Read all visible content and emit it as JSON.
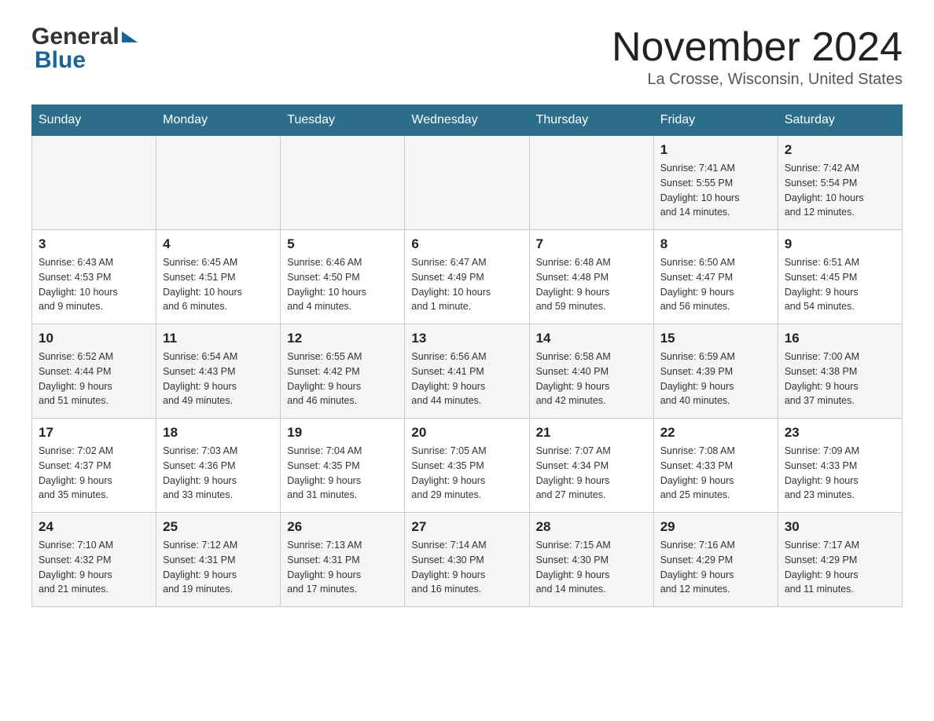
{
  "logo": {
    "line1": "General",
    "line2": "Blue"
  },
  "header": {
    "month": "November 2024",
    "location": "La Crosse, Wisconsin, United States"
  },
  "weekdays": [
    "Sunday",
    "Monday",
    "Tuesday",
    "Wednesday",
    "Thursday",
    "Friday",
    "Saturday"
  ],
  "weeks": [
    [
      {
        "day": "",
        "info": ""
      },
      {
        "day": "",
        "info": ""
      },
      {
        "day": "",
        "info": ""
      },
      {
        "day": "",
        "info": ""
      },
      {
        "day": "",
        "info": ""
      },
      {
        "day": "1",
        "info": "Sunrise: 7:41 AM\nSunset: 5:55 PM\nDaylight: 10 hours\nand 14 minutes."
      },
      {
        "day": "2",
        "info": "Sunrise: 7:42 AM\nSunset: 5:54 PM\nDaylight: 10 hours\nand 12 minutes."
      }
    ],
    [
      {
        "day": "3",
        "info": "Sunrise: 6:43 AM\nSunset: 4:53 PM\nDaylight: 10 hours\nand 9 minutes."
      },
      {
        "day": "4",
        "info": "Sunrise: 6:45 AM\nSunset: 4:51 PM\nDaylight: 10 hours\nand 6 minutes."
      },
      {
        "day": "5",
        "info": "Sunrise: 6:46 AM\nSunset: 4:50 PM\nDaylight: 10 hours\nand 4 minutes."
      },
      {
        "day": "6",
        "info": "Sunrise: 6:47 AM\nSunset: 4:49 PM\nDaylight: 10 hours\nand 1 minute."
      },
      {
        "day": "7",
        "info": "Sunrise: 6:48 AM\nSunset: 4:48 PM\nDaylight: 9 hours\nand 59 minutes."
      },
      {
        "day": "8",
        "info": "Sunrise: 6:50 AM\nSunset: 4:47 PM\nDaylight: 9 hours\nand 56 minutes."
      },
      {
        "day": "9",
        "info": "Sunrise: 6:51 AM\nSunset: 4:45 PM\nDaylight: 9 hours\nand 54 minutes."
      }
    ],
    [
      {
        "day": "10",
        "info": "Sunrise: 6:52 AM\nSunset: 4:44 PM\nDaylight: 9 hours\nand 51 minutes."
      },
      {
        "day": "11",
        "info": "Sunrise: 6:54 AM\nSunset: 4:43 PM\nDaylight: 9 hours\nand 49 minutes."
      },
      {
        "day": "12",
        "info": "Sunrise: 6:55 AM\nSunset: 4:42 PM\nDaylight: 9 hours\nand 46 minutes."
      },
      {
        "day": "13",
        "info": "Sunrise: 6:56 AM\nSunset: 4:41 PM\nDaylight: 9 hours\nand 44 minutes."
      },
      {
        "day": "14",
        "info": "Sunrise: 6:58 AM\nSunset: 4:40 PM\nDaylight: 9 hours\nand 42 minutes."
      },
      {
        "day": "15",
        "info": "Sunrise: 6:59 AM\nSunset: 4:39 PM\nDaylight: 9 hours\nand 40 minutes."
      },
      {
        "day": "16",
        "info": "Sunrise: 7:00 AM\nSunset: 4:38 PM\nDaylight: 9 hours\nand 37 minutes."
      }
    ],
    [
      {
        "day": "17",
        "info": "Sunrise: 7:02 AM\nSunset: 4:37 PM\nDaylight: 9 hours\nand 35 minutes."
      },
      {
        "day": "18",
        "info": "Sunrise: 7:03 AM\nSunset: 4:36 PM\nDaylight: 9 hours\nand 33 minutes."
      },
      {
        "day": "19",
        "info": "Sunrise: 7:04 AM\nSunset: 4:35 PM\nDaylight: 9 hours\nand 31 minutes."
      },
      {
        "day": "20",
        "info": "Sunrise: 7:05 AM\nSunset: 4:35 PM\nDaylight: 9 hours\nand 29 minutes."
      },
      {
        "day": "21",
        "info": "Sunrise: 7:07 AM\nSunset: 4:34 PM\nDaylight: 9 hours\nand 27 minutes."
      },
      {
        "day": "22",
        "info": "Sunrise: 7:08 AM\nSunset: 4:33 PM\nDaylight: 9 hours\nand 25 minutes."
      },
      {
        "day": "23",
        "info": "Sunrise: 7:09 AM\nSunset: 4:33 PM\nDaylight: 9 hours\nand 23 minutes."
      }
    ],
    [
      {
        "day": "24",
        "info": "Sunrise: 7:10 AM\nSunset: 4:32 PM\nDaylight: 9 hours\nand 21 minutes."
      },
      {
        "day": "25",
        "info": "Sunrise: 7:12 AM\nSunset: 4:31 PM\nDaylight: 9 hours\nand 19 minutes."
      },
      {
        "day": "26",
        "info": "Sunrise: 7:13 AM\nSunset: 4:31 PM\nDaylight: 9 hours\nand 17 minutes."
      },
      {
        "day": "27",
        "info": "Sunrise: 7:14 AM\nSunset: 4:30 PM\nDaylight: 9 hours\nand 16 minutes."
      },
      {
        "day": "28",
        "info": "Sunrise: 7:15 AM\nSunset: 4:30 PM\nDaylight: 9 hours\nand 14 minutes."
      },
      {
        "day": "29",
        "info": "Sunrise: 7:16 AM\nSunset: 4:29 PM\nDaylight: 9 hours\nand 12 minutes."
      },
      {
        "day": "30",
        "info": "Sunrise: 7:17 AM\nSunset: 4:29 PM\nDaylight: 9 hours\nand 11 minutes."
      }
    ]
  ]
}
